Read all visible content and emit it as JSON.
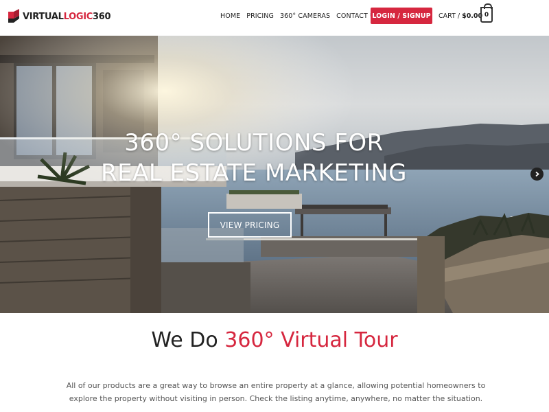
{
  "brand": {
    "logo_part1": "VIRTUAL",
    "logo_part2": "LOGIC",
    "logo_part3": "360",
    "accent_color": "#d6273f"
  },
  "nav": {
    "items": [
      "HOME",
      "PRICING",
      "360° CAMERAS",
      "CONTACT US"
    ],
    "login_label": "LOGIN / SIGNUP",
    "cart_label": "CART /",
    "cart_total": "$0.00",
    "cart_count": "0"
  },
  "hero": {
    "title_line1": "360° SOLUTIONS FOR",
    "title_line2": "REAL ESTATE MARKETING",
    "cta_label": "VIEW PRICING",
    "next_icon": "chevron-right-icon"
  },
  "intro": {
    "title_plain": "We Do",
    "title_accent": "360° Virtual Tour",
    "body": "All of our products are a great way to browse an entire property at a glance, allowing potential homeowners to explore the property without visiting in person. Check the listing anytime, anywhere, no matter the situation."
  }
}
